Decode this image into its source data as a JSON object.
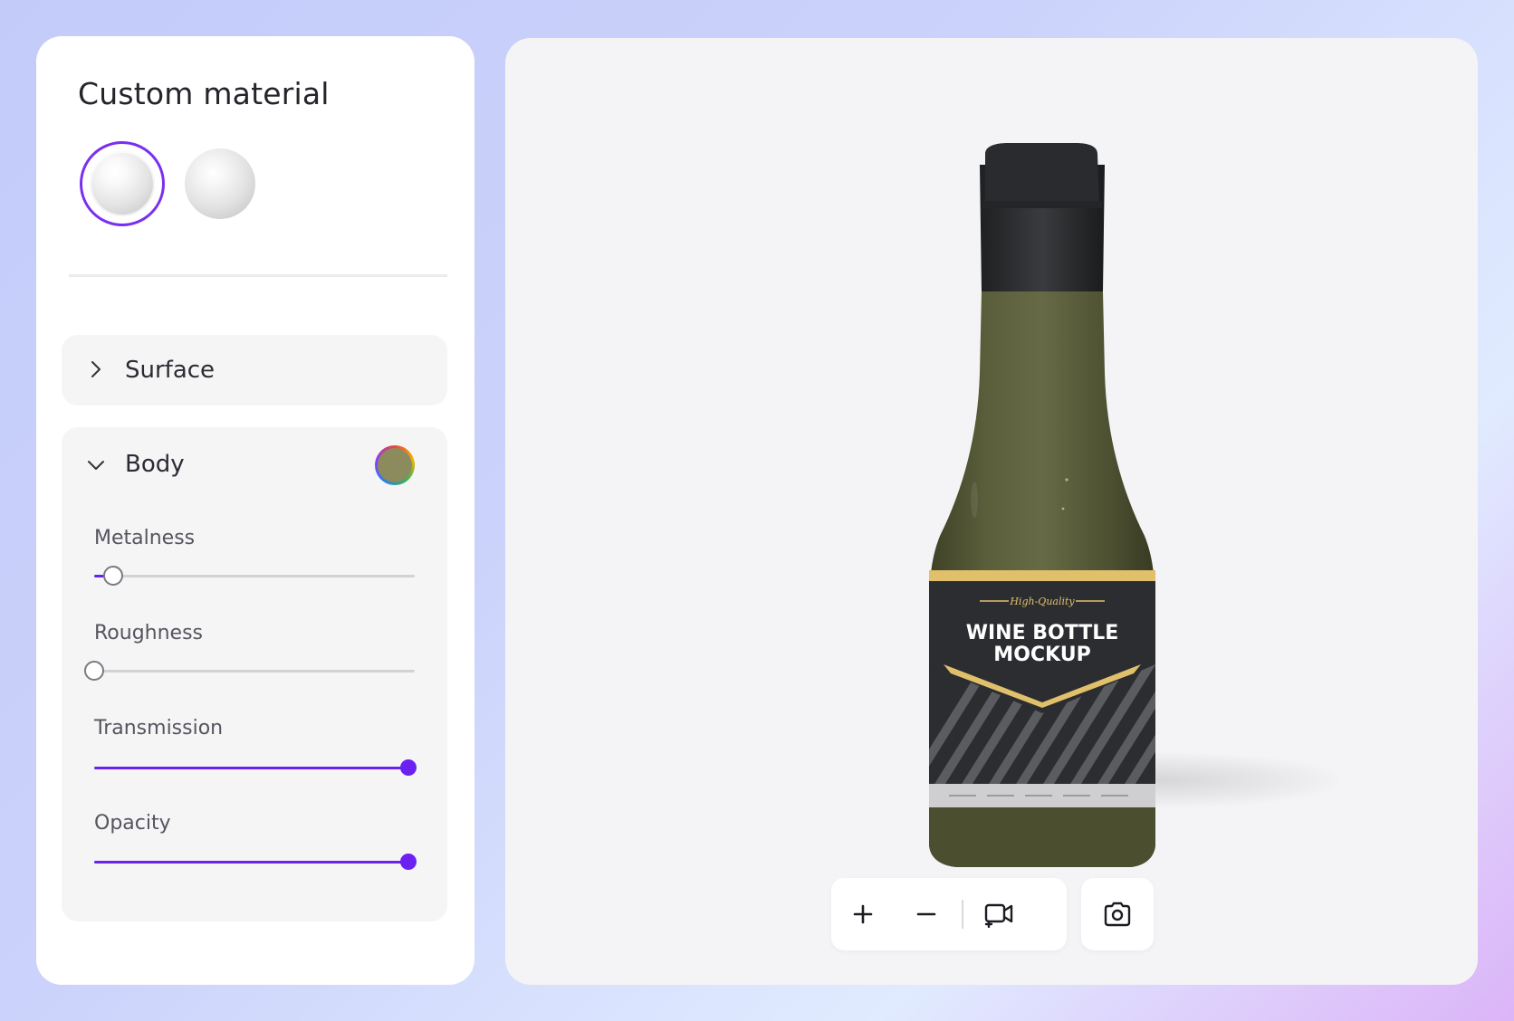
{
  "panel": {
    "title": "Custom material",
    "materials": [
      {
        "name": "glossy-sphere",
        "selected": true
      },
      {
        "name": "matte-sphere",
        "selected": false
      }
    ]
  },
  "accordions": {
    "surface": {
      "label": "Surface",
      "expanded": false
    },
    "body": {
      "label": "Body",
      "expanded": true,
      "color": "#8c8b5e",
      "sliders": [
        {
          "label": "Metalness",
          "value": 0.06
        },
        {
          "label": "Roughness",
          "value": 0.0
        },
        {
          "label": "Transmission",
          "value": 0.98
        },
        {
          "label": "Opacity",
          "value": 0.98
        }
      ]
    }
  },
  "bottle_label": {
    "tag": "High-Quality",
    "line1": "WINE BOTTLE",
    "line2": "MOCKUP"
  },
  "toolbar": {
    "zoom_in": "zoom-in",
    "zoom_out": "zoom-out",
    "record": "record-video",
    "screenshot": "screenshot"
  },
  "colors": {
    "accent": "#6b22f0",
    "bottle_glass": "#4e5233",
    "label_dark": "#2c2d31",
    "label_gold": "#e0c06a"
  }
}
